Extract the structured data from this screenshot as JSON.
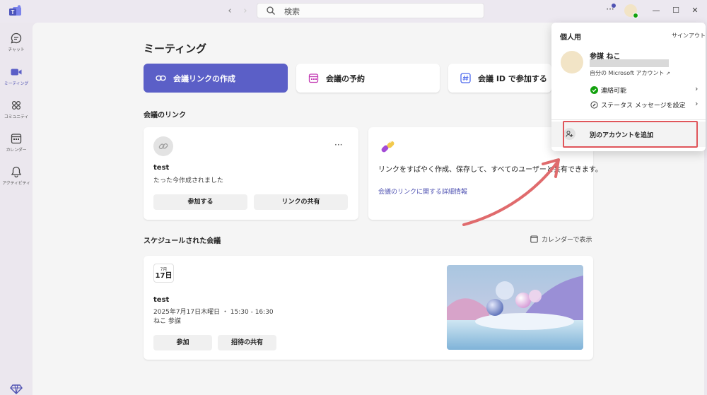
{
  "titlebar": {
    "search_placeholder": "検索",
    "more_label": "···",
    "min_label": "—",
    "max_label": "☐",
    "close_label": "✕"
  },
  "rail": {
    "items": [
      {
        "label": "チャット",
        "icon": "chat-icon"
      },
      {
        "label": "ミーティング",
        "icon": "video-camera-icon"
      },
      {
        "label": "コミュニティ",
        "icon": "community-icon"
      },
      {
        "label": "カレンダー",
        "icon": "calendar-icon"
      },
      {
        "label": "アクティビティ",
        "icon": "bell-icon"
      }
    ]
  },
  "page": {
    "title": "ミーティング",
    "actions": [
      {
        "label": "会議リンクの作成",
        "icon": "link-icon"
      },
      {
        "label": "会議の予約",
        "icon": "calendar-icon"
      },
      {
        "label": "会議 ID で参加する",
        "icon": "hash-icon"
      }
    ],
    "links_section": "会議のリンク",
    "link_card": {
      "name": "test",
      "subtitle": "たった今作成されました",
      "more": "···",
      "join_label": "参加する",
      "share_label": "リンクの共有"
    },
    "promo_card": {
      "text": "リンクをすばやく作成、保存して、すべてのユーザーと共有できます。",
      "link": "会議のリンクに関する詳細情報"
    },
    "scheduled_section": "スケジュールされた会議",
    "calendar_view_label": "カレンダーで表示",
    "meeting_card": {
      "month": "7月",
      "day": "17日",
      "name": "test",
      "datetime": "2025年7月17日木曜日 ・ 15:30 - 16:30",
      "organizer": "ねこ 参謀",
      "join_label": "参加",
      "share_label": "招待の共有"
    }
  },
  "flyout": {
    "header": "個人用",
    "signout": "サインアウト",
    "name": "参謀 ねこ",
    "account_link": "自分の Microsoft アカウント",
    "status": "連絡可能",
    "status_message": "ステータス メッセージを設定",
    "add_account": "別のアカウントを追加"
  },
  "colors": {
    "accent": "#5b5fc7",
    "available": "#13a10e",
    "highlight": "#e0555a"
  }
}
